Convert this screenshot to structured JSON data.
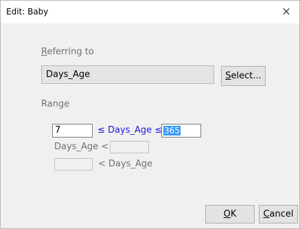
{
  "window": {
    "title": "Edit: Baby",
    "close_glyph": "×"
  },
  "referring": {
    "label_mnemonic": "R",
    "label_rest": "eferring to",
    "field_value": "Days_Age",
    "select_mnemonic": "S",
    "select_rest": "elect..."
  },
  "range": {
    "label_pre": "Ran",
    "label_mnemonic": "g",
    "label_post": "e",
    "min_value": "7",
    "between_expr": "≤ Days_Age ≤",
    "max_value": "365",
    "less_than_expr": "Days_Age <",
    "less_than_value": "",
    "greater_than_value": "",
    "greater_than_expr": "< Days_Age"
  },
  "footer": {
    "ok_mnemonic": "O",
    "ok_rest": "K",
    "cancel_pre": "",
    "cancel_mnemonic": "C",
    "cancel_rest": "ancel"
  }
}
